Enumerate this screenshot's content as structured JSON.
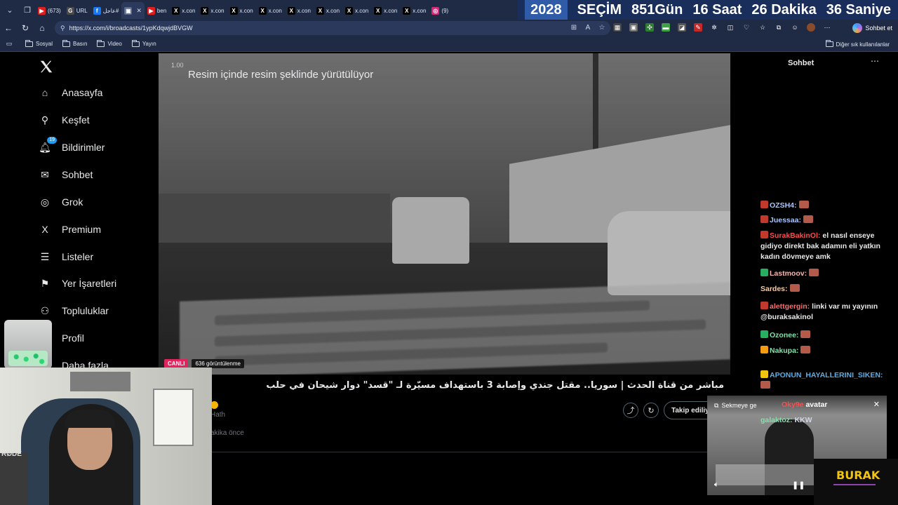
{
  "browser": {
    "tabs": [
      {
        "label": "(673)",
        "favicon": "youtube-icon"
      },
      {
        "label": "URL",
        "favicon": "grok-icon"
      },
      {
        "label": "‏عاجل#",
        "favicon": "facebook-icon"
      },
      {
        "label": "",
        "favicon": "picture-icon",
        "active": true
      },
      {
        "label": "ben",
        "favicon": "youtube-icon"
      },
      {
        "label": "x.con",
        "favicon": "x-icon"
      },
      {
        "label": "x.con",
        "favicon": "x-icon"
      },
      {
        "label": "x.con",
        "favicon": "x-icon"
      },
      {
        "label": "x.con",
        "favicon": "x-icon"
      },
      {
        "label": "x.con",
        "favicon": "x-icon"
      },
      {
        "label": "x.con",
        "favicon": "x-icon"
      },
      {
        "label": "x.con",
        "favicon": "x-icon"
      },
      {
        "label": "x.con",
        "favicon": "x-icon"
      },
      {
        "label": "x.con",
        "favicon": "x-icon"
      },
      {
        "label": "(9)",
        "favicon": "instagram-icon"
      }
    ],
    "url": "https://x.com/i/broadcasts/1ypKdqwjdBVGW",
    "copilot_label": "Sohbet et",
    "bookmarks": [
      "Sosyal",
      "Basın",
      "Video",
      "Yayın"
    ],
    "other_favorites": "Diğer sık kullanılanlar"
  },
  "countdown": {
    "year": "2028",
    "label": "SEÇİM",
    "days": "851Gün",
    "hours": "16 Saat",
    "minutes": "26 Dakika",
    "seconds": "36 Saniye"
  },
  "sidebar": {
    "items": [
      {
        "label": "Anasayfa",
        "icon": "home-icon"
      },
      {
        "label": "Keşfet",
        "icon": "search-icon"
      },
      {
        "label": "Bildirimler",
        "icon": "bell-icon",
        "badge": "19"
      },
      {
        "label": "Sohbet",
        "icon": "mail-icon"
      },
      {
        "label": "Grok",
        "icon": "grok-icon"
      },
      {
        "label": "Premium",
        "icon": "x-icon"
      },
      {
        "label": "Listeler",
        "icon": "list-icon"
      },
      {
        "label": "Yer İşaretleri",
        "icon": "bookmark-icon"
      },
      {
        "label": "Topluluklar",
        "icon": "community-icon"
      },
      {
        "label": "Profil",
        "icon": "profile-icon"
      },
      {
        "label": "Daha fazla",
        "icon": "more-icon"
      }
    ]
  },
  "video": {
    "speed": "1.00",
    "pip_message": "Resim içinde resim şeklinde yürütülüyor",
    "live_label": "CANLI",
    "views": "636 görüntülenme"
  },
  "broadcast": {
    "title": "مباشر من قناة الحدث | سوريا.. مقتل جندي وإصابة 3 باستهداف مسيّرة لـ \"قسد\" دوار شيحان في حلب",
    "host_fragment": "Hath",
    "time_fragment": "akika önce",
    "follow_label": "Takip ediliyor"
  },
  "chat": {
    "title": "Sohbet",
    "messages": [
      {
        "user": "OZSH4:",
        "text": "",
        "user_color": "#a9c6ff",
        "badge_color": "#c0392b"
      },
      {
        "user": "Juessaa:",
        "text": "",
        "user_color": "#a9c6ff",
        "badge_color": "#c0392b"
      },
      {
        "user": "SurakBakinOl:",
        "text": "el nasıl enseye gidiyo direkt bak adamın eli yatkın kadın dövmeye amk",
        "user_color": "#ff4d4d",
        "badge_color": "#c0392b"
      },
      {
        "user": "Lastmoov:",
        "text": "",
        "user_color": "#f5b7b1",
        "badge_color": "#27ae60"
      },
      {
        "user": "Sardes:",
        "text": "",
        "user_color": "#f5cba7",
        "badge_color": ""
      },
      {
        "user": "alettgergin:",
        "text": "linki var mı yayının @buraksakinol",
        "user_color": "#ff6b6b",
        "badge_color": "#c0392b"
      },
      {
        "user": "Ozonee:",
        "text": "",
        "user_color": "#82e0aa",
        "badge_color": "#27ae60"
      },
      {
        "user": "Nakupa:",
        "text": "",
        "user_color": "#82e0aa",
        "badge_color": "#f39c12"
      },
      {
        "user": "APONUN_HAYALLERINI_SIKEN:",
        "text": "",
        "user_color": "#5dade2",
        "badge_color": "#f1c40f"
      }
    ]
  },
  "mini_player": {
    "open_tab_label": "Sekmeye ge",
    "overlay_user": "Oky9e",
    "overlay_text": "avatar",
    "overlay_user2": "galaktoz:",
    "overlay_text2": "KKW"
  },
  "stream_overlay": {
    "logo_text": "BURAK",
    "webcam_mic_label": "RØDE"
  },
  "colors": {
    "accent": "#1d9bf0",
    "live": "#e0245e",
    "logo": "#f1c40f"
  }
}
